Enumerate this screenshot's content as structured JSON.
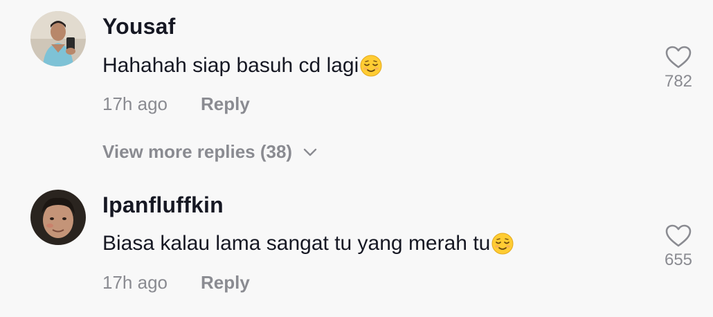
{
  "comments": [
    {
      "username": "Yousaf",
      "text": "Hahahah siap basuh cd lagi",
      "emoji": "relieved-face-emoji",
      "time": "17h ago",
      "reply_label": "Reply",
      "likes": "782"
    },
    {
      "username": "Ipanfluffkin",
      "text": "Biasa kalau lama sangat tu yang merah tu",
      "emoji": "relieved-face-emoji",
      "time": "17h ago",
      "reply_label": "Reply",
      "likes": "655"
    }
  ],
  "view_more_replies": {
    "label": "View more replies (38)",
    "icon": "chevron-down-icon"
  },
  "colors": {
    "background": "#f8f8f8",
    "primary_text": "#161823",
    "secondary_text": "#8a8b91"
  }
}
